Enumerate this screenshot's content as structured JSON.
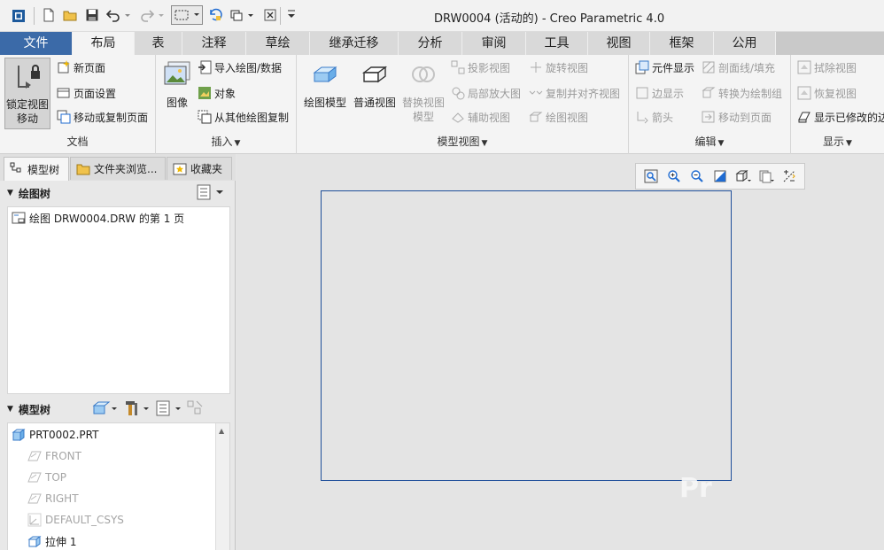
{
  "window": {
    "title": "DRW0004 (活动的) - Creo Parametric 4.0"
  },
  "tabs": [
    {
      "label": "文件"
    },
    {
      "label": "布局"
    },
    {
      "label": "表"
    },
    {
      "label": "注释"
    },
    {
      "label": "草绘"
    },
    {
      "label": "继承迁移"
    },
    {
      "label": "分析"
    },
    {
      "label": "审阅"
    },
    {
      "label": "工具"
    },
    {
      "label": "视图"
    },
    {
      "label": "框架"
    },
    {
      "label": "公用"
    }
  ],
  "ribbon": {
    "document": {
      "label": "文档",
      "lock_view": "锁定视图\n移动",
      "lock_view_l1": "锁定视图",
      "lock_view_l2": "移动",
      "new_page": "新页面",
      "page_setup": "页面设置",
      "move_copy_page": "移动或复制页面"
    },
    "insert": {
      "label": "插入",
      "image": "图像",
      "import_drawing": "导入绘图/数据",
      "object": "对象",
      "copy_from_other": "从其他绘图复制"
    },
    "model_views": {
      "label": "模型视图",
      "drawing_model": "绘图模型",
      "general_view": "普通视图",
      "replace_view_l1": "替换视图",
      "replace_view_l2": "模型",
      "projection_view": "投影视图",
      "detailed_view": "局部放大图",
      "auxiliary_view": "辅助视图",
      "revolved_view": "旋转视图",
      "copy_align_view": "复制并对齐视图",
      "drawing_view": "绘图视图"
    },
    "edit": {
      "label": "编辑",
      "component_display": "元件显示",
      "edge_display": "边显示",
      "arrow": "箭头",
      "section_fill": "剖面线/填充",
      "convert_group": "转换为绘制组",
      "move_to_page": "移动到页面"
    },
    "display": {
      "label": "显示",
      "erase_view": "拭除视图",
      "resume_view": "恢复视图",
      "show_modified": "显示已修改的边"
    }
  },
  "left_panel": {
    "tabs": [
      {
        "label": "模型树"
      },
      {
        "label": "文件夹浏览..."
      },
      {
        "label": "收藏夹"
      }
    ],
    "drawing_tree": {
      "header": "绘图树",
      "items": [
        {
          "label": "绘图 DRW0004.DRW 的第 1 页"
        }
      ]
    },
    "model_tree": {
      "header": "模型树",
      "items": [
        {
          "label": "PRT0002.PRT",
          "icon": "part-icon",
          "dim": false
        },
        {
          "label": "FRONT",
          "icon": "datum-plane-icon",
          "dim": true
        },
        {
          "label": "TOP",
          "icon": "datum-plane-icon",
          "dim": true
        },
        {
          "label": "RIGHT",
          "icon": "datum-plane-icon",
          "dim": true
        },
        {
          "label": "DEFAULT_CSYS",
          "icon": "coordinate-system-icon",
          "dim": true
        },
        {
          "label": "拉伸 1",
          "icon": "extrude-icon",
          "dim": false
        }
      ]
    }
  },
  "colors": {
    "file_tab": "#3b6aa8",
    "sheet_border": "#1f4f9a",
    "ribbon_bg": "#f4f4f4",
    "canvas_bg": "#e4e4e4"
  }
}
